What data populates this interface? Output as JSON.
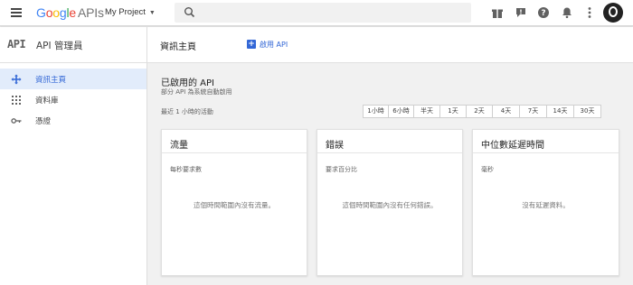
{
  "topbar": {
    "logo": {
      "g1": "G",
      "g2": "o",
      "g3": "o",
      "g4": "g",
      "g5": "l",
      "g6": "e",
      "apis": "APIs"
    },
    "project_name": "My Project",
    "icons": [
      "menu-icon",
      "gift-icon",
      "alert-icon",
      "help-icon",
      "bell-icon",
      "more-vert-icon",
      "avatar"
    ]
  },
  "sidebar": {
    "logo_text": "API",
    "title": "API 管理員",
    "items": [
      {
        "label": "資訊主頁",
        "icon": "dashboard-icon",
        "active": true
      },
      {
        "label": "資料庫",
        "icon": "library-icon",
        "active": false
      },
      {
        "label": "憑證",
        "icon": "key-icon",
        "active": false
      }
    ]
  },
  "main": {
    "title": "資訊主頁",
    "enable_label": "啟用 API",
    "section_title": "已啟用的 API",
    "section_subtitle": "部分 API 為系統自動啟用",
    "activity_label": "最近 1 小時的活動",
    "ranges": [
      "1小時",
      "6小時",
      "半天",
      "1天",
      "2天",
      "4天",
      "7天",
      "14天",
      "30天"
    ],
    "cards": [
      {
        "title": "流量",
        "unit": "每秒要求數",
        "empty": "這個時間範圍內沒有流量。"
      },
      {
        "title": "錯誤",
        "unit": "要求百分比",
        "empty": "這個時間範圍內沒有任何錯誤。"
      },
      {
        "title": "中位數延遲時間",
        "unit": "毫秒",
        "empty": "沒有延遲資料。"
      }
    ]
  },
  "colors": {
    "accent": "#3367d6",
    "active_bg": "#e2ecfb"
  }
}
